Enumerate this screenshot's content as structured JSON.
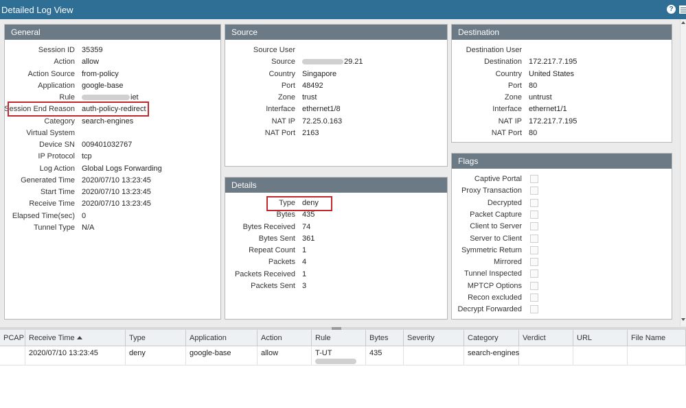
{
  "window": {
    "title": "Detailed Log View"
  },
  "general": {
    "header": "General",
    "rows": [
      {
        "label": "Session ID",
        "value": "35359"
      },
      {
        "label": "Action",
        "value": "allow"
      },
      {
        "label": "Action Source",
        "value": "from-policy"
      },
      {
        "label": "Application",
        "value": "google-base"
      },
      {
        "label": "Rule",
        "value": "iet"
      },
      {
        "label": "Session End Reason",
        "value": "auth-policy-redirect"
      },
      {
        "label": "Category",
        "value": "search-engines"
      },
      {
        "label": "Virtual System",
        "value": ""
      },
      {
        "label": "Device SN",
        "value": "009401032767"
      },
      {
        "label": "IP Protocol",
        "value": "tcp"
      },
      {
        "label": "Log Action",
        "value": "Global Logs Forwarding"
      },
      {
        "label": "Generated Time",
        "value": "2020/07/10 13:23:45"
      },
      {
        "label": "Start Time",
        "value": "2020/07/10 13:23:45"
      },
      {
        "label": "Receive Time",
        "value": "2020/07/10 13:23:45"
      },
      {
        "label": "Elapsed Time(sec)",
        "value": "0"
      },
      {
        "label": "Tunnel Type",
        "value": "N/A"
      }
    ]
  },
  "source": {
    "header": "Source",
    "rows": [
      {
        "label": "Source User",
        "value": ""
      },
      {
        "label": "Source",
        "value": "29.21"
      },
      {
        "label": "Country",
        "value": "Singapore"
      },
      {
        "label": "Port",
        "value": "48492"
      },
      {
        "label": "Zone",
        "value": "trust"
      },
      {
        "label": "Interface",
        "value": "ethernet1/8"
      },
      {
        "label": "NAT IP",
        "value": "72.25.0.163"
      },
      {
        "label": "NAT Port",
        "value": "2163"
      }
    ]
  },
  "destination": {
    "header": "Destination",
    "rows": [
      {
        "label": "Destination User",
        "value": ""
      },
      {
        "label": "Destination",
        "value": "172.217.7.195"
      },
      {
        "label": "Country",
        "value": "United States"
      },
      {
        "label": "Port",
        "value": "80"
      },
      {
        "label": "Zone",
        "value": "untrust"
      },
      {
        "label": "Interface",
        "value": "ethernet1/1"
      },
      {
        "label": "NAT IP",
        "value": "172.217.7.195"
      },
      {
        "label": "NAT Port",
        "value": "80"
      }
    ]
  },
  "details": {
    "header": "Details",
    "rows": [
      {
        "label": "Type",
        "value": "deny"
      },
      {
        "label": "Bytes",
        "value": "435"
      },
      {
        "label": "Bytes Received",
        "value": "74"
      },
      {
        "label": "Bytes Sent",
        "value": "361"
      },
      {
        "label": "Repeat Count",
        "value": "1"
      },
      {
        "label": "Packets",
        "value": "4"
      },
      {
        "label": "Packets Received",
        "value": "1"
      },
      {
        "label": "Packets Sent",
        "value": "3"
      }
    ]
  },
  "flags": {
    "header": "Flags",
    "items": [
      {
        "label": "Captive Portal",
        "checked": false
      },
      {
        "label": "Proxy Transaction",
        "checked": false
      },
      {
        "label": "Decrypted",
        "checked": false
      },
      {
        "label": "Packet Capture",
        "checked": false
      },
      {
        "label": "Client to Server",
        "checked": false
      },
      {
        "label": "Server to Client",
        "checked": false
      },
      {
        "label": "Symmetric Return",
        "checked": false
      },
      {
        "label": "Mirrored",
        "checked": false
      },
      {
        "label": "Tunnel Inspected",
        "checked": false
      },
      {
        "label": "MPTCP Options",
        "checked": false
      },
      {
        "label": "Recon excluded",
        "checked": false
      },
      {
        "label": "Decrypt Forwarded",
        "checked": false
      }
    ]
  },
  "table": {
    "columns": [
      "PCAP",
      "Receive Time",
      "Type",
      "Application",
      "Action",
      "Rule",
      "Bytes",
      "Severity",
      "Category",
      "Verdict",
      "URL",
      "File Name"
    ],
    "rows": [
      [
        "",
        "2020/07/10 13:23:45",
        "deny",
        "google-base",
        "allow",
        "T-UT",
        "435",
        "",
        "search-engines",
        "",
        "",
        ""
      ]
    ]
  }
}
